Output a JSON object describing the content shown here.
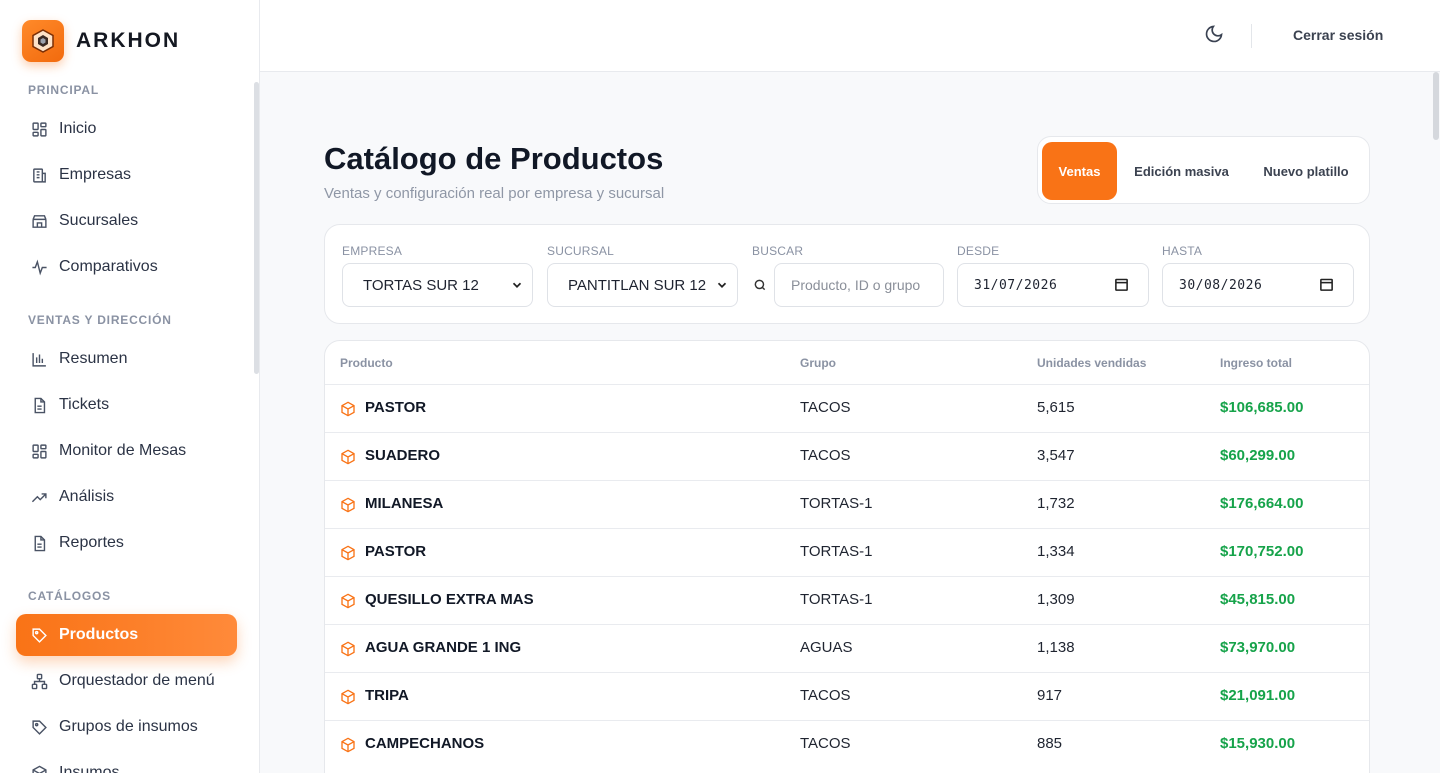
{
  "brand": {
    "name": "ARKHON"
  },
  "sidebar": {
    "sections": [
      "PRINCIPAL",
      "VENTAS Y DIRECCIÓN",
      "CATÁLOGOS"
    ],
    "items": [
      {
        "label": "Inicio",
        "icon": "grid-icon"
      },
      {
        "label": "Empresas",
        "icon": "building-icon"
      },
      {
        "label": "Sucursales",
        "icon": "store-icon"
      },
      {
        "label": "Comparativos",
        "icon": "activity-icon"
      },
      {
        "label": "Resumen",
        "icon": "bar-chart-icon"
      },
      {
        "label": "Tickets",
        "icon": "document-icon"
      },
      {
        "label": "Monitor de Mesas",
        "icon": "grid-icon"
      },
      {
        "label": "Análisis",
        "icon": "trending-up-icon"
      },
      {
        "label": "Reportes",
        "icon": "document-icon"
      },
      {
        "label": "Productos",
        "icon": "tag-icon",
        "active": true
      },
      {
        "label": "Orquestador de menú",
        "icon": "sitemap-icon"
      },
      {
        "label": "Grupos de insumos",
        "icon": "tag-icon"
      },
      {
        "label": "Insumos",
        "icon": "package-icon"
      }
    ]
  },
  "topbar": {
    "logout": "Cerrar sesión",
    "theme_icon": "moon-icon"
  },
  "page": {
    "title": "Catálogo de Productos",
    "subtitle": "Ventas y configuración real por empresa y sucursal"
  },
  "tabs": [
    {
      "label": "Ventas",
      "active": true
    },
    {
      "label": "Edición masiva"
    },
    {
      "label": "Nuevo platillo"
    }
  ],
  "filters": {
    "empresa": {
      "label": "EMPRESA",
      "value": "TORTAS SUR 12"
    },
    "sucursal": {
      "label": "SUCURSAL",
      "value": "PANTITLAN SUR 12"
    },
    "buscar": {
      "label": "BUSCAR",
      "placeholder": "Producto, ID o grupo"
    },
    "desde": {
      "label": "DESDE",
      "value": "31/07/2026"
    },
    "hasta": {
      "label": "HASTA",
      "value": "30/08/2026"
    }
  },
  "table": {
    "columns": [
      "Producto",
      "Grupo",
      "Unidades vendidas",
      "Ingreso total"
    ],
    "rows": [
      {
        "producto": "PASTOR",
        "grupo": "TACOS",
        "unidades": "5,615",
        "ingreso": "$106,685.00"
      },
      {
        "producto": "SUADERO",
        "grupo": "TACOS",
        "unidades": "3,547",
        "ingreso": "$60,299.00"
      },
      {
        "producto": "MILANESA",
        "grupo": "TORTAS-1",
        "unidades": "1,732",
        "ingreso": "$176,664.00"
      },
      {
        "producto": "PASTOR",
        "grupo": "TORTAS-1",
        "unidades": "1,334",
        "ingreso": "$170,752.00"
      },
      {
        "producto": "QUESILLO EXTRA MAS",
        "grupo": "TORTAS-1",
        "unidades": "1,309",
        "ingreso": "$45,815.00"
      },
      {
        "producto": "AGUA GRANDE 1 ING",
        "grupo": "AGUAS",
        "unidades": "1,138",
        "ingreso": "$73,970.00"
      },
      {
        "producto": "TRIPA",
        "grupo": "TACOS",
        "unidades": "917",
        "ingreso": "$21,091.00"
      },
      {
        "producto": "CAMPECHANOS",
        "grupo": "TACOS",
        "unidades": "885",
        "ingreso": "$15,930.00"
      }
    ]
  },
  "colors": {
    "accent": "#f97316",
    "money": "#16a34a"
  }
}
